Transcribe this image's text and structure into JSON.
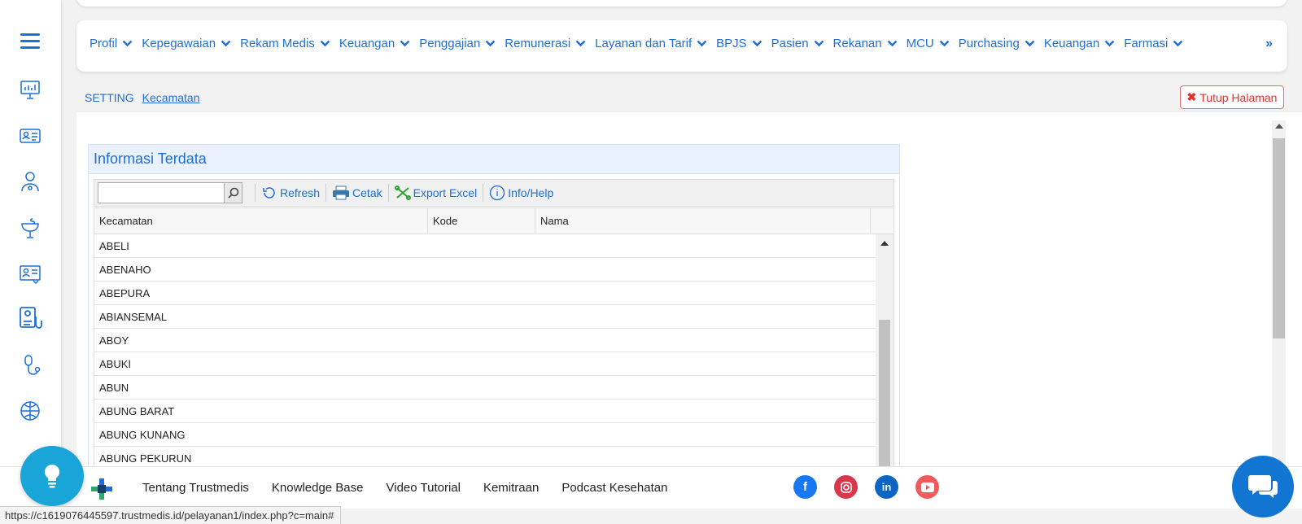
{
  "nav": {
    "items": [
      "Profil",
      "Kepegawaian",
      "Rekam Medis",
      "Keuangan",
      "Penggajian",
      "Remunerasi",
      "Layanan dan Tarif",
      "BPJS",
      "Pasien",
      "Rekanan",
      "MCU",
      "Purchasing",
      "Keuangan",
      "Farmasi"
    ],
    "more": "»"
  },
  "breadcrumb": {
    "root": "SETTING",
    "current": "Kecamatan"
  },
  "close_button": "Tutup Halaman",
  "panel": {
    "title": "Informasi Terdata",
    "search": {
      "value": "",
      "placeholder": ""
    },
    "toolbar": {
      "refresh": "Refresh",
      "print": "Cetak",
      "export": "Export Excel",
      "help": "Info/Help"
    },
    "columns": [
      "Kecamatan",
      "Kode",
      "Nama"
    ],
    "rows": [
      "ABELI",
      "ABENAHO",
      "ABEPURA",
      "ABIANSEMAL",
      "ABOY",
      "ABUKI",
      "ABUN",
      "ABUNG BARAT",
      "ABUNG KUNANG",
      "ABUNG PEKURUN"
    ]
  },
  "footer": {
    "links": [
      "Tentang Trustmedis",
      "Knowledge Base",
      "Video Tutorial",
      "Kemitraan",
      "Podcast Kesehatan"
    ],
    "social": [
      "facebook-icon",
      "instagram-icon",
      "linkedin-icon",
      "youtube-icon"
    ]
  },
  "status_url": "https://c1619076445597.trustmedis.id/pelayanan1/index.php?c=main#",
  "colors": {
    "accent": "#1e6ed8",
    "danger": "#e0312b",
    "header_bg": "#e8f1fd"
  }
}
